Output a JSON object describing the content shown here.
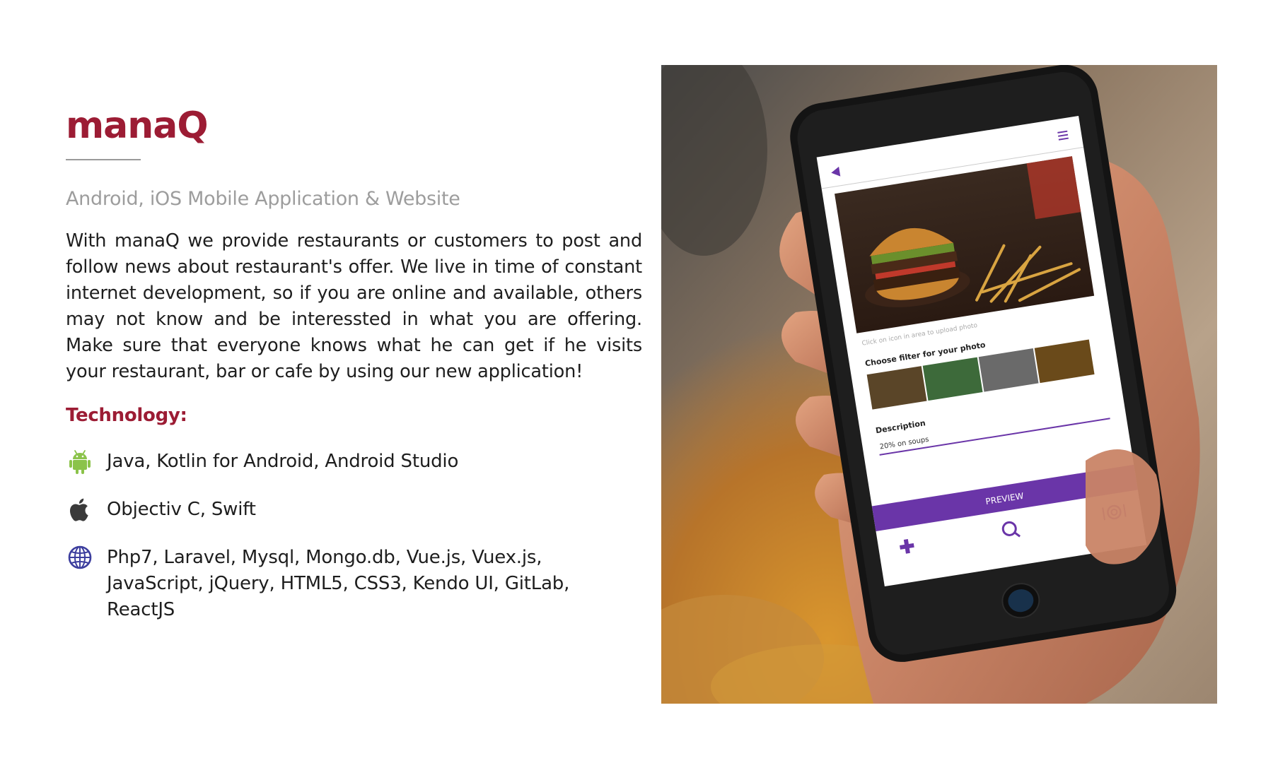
{
  "title": "manaQ",
  "subtitle": "Android, iOS Mobile Application & Website",
  "description": "With manaQ we provide restaurants or customers to post and follow news about restaurant's offer. We live in time of constant internet development, so if you are online and available, others may not know and be interessted in what you are offering. Make sure that everyone knows what he can get if he visits your restaurant, bar or cafe by using our new application!",
  "technology_heading": "Technology:",
  "technologies": [
    {
      "icon": "android-icon",
      "text": "Java, Kotlin for Android, Android Studio"
    },
    {
      "icon": "apple-icon",
      "text": "Objectiv C, Swift"
    },
    {
      "icon": "globe-icon",
      "text": "Php7, Laravel, Mysql, Mongo.db, Vue.js, Vuex.js, JavaScript, jQuery, HTML5, CSS3, Kendo UI, GitLab, ReactJS"
    }
  ],
  "phone_screen": {
    "upload_hint": "Click on icon in area to upload photo",
    "filter_label": "Choose filter for your photo",
    "description_label": "Description",
    "description_value": "20% on soups",
    "preview_button": "PREVIEW"
  },
  "colors": {
    "brand": "#9c1c34",
    "app_accent": "#6a35a8",
    "android_green": "#8bc34a"
  }
}
